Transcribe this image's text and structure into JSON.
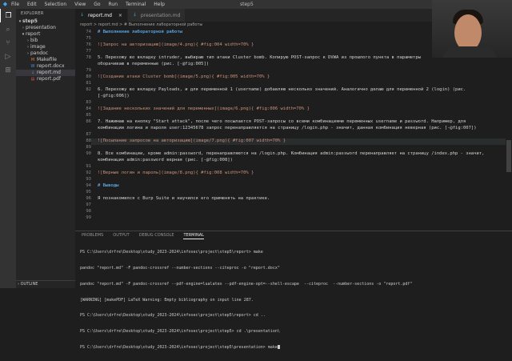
{
  "window": {
    "title": "step5",
    "menu": [
      "File",
      "Edit",
      "Selection",
      "View",
      "Go",
      "Run",
      "Terminal",
      "Help"
    ]
  },
  "sidebar": {
    "header": "EXPLORER",
    "root": "step5",
    "items": [
      {
        "label": "presentation",
        "kind": "folder",
        "collapsed": true
      },
      {
        "label": "report",
        "kind": "folder",
        "collapsed": false
      },
      {
        "label": "bib",
        "kind": "folder",
        "collapsed": true
      },
      {
        "label": "image",
        "kind": "folder",
        "collapsed": true
      },
      {
        "label": "pandoc",
        "kind": "folder",
        "collapsed": true
      },
      {
        "label": "Makefile",
        "kind": "file"
      },
      {
        "label": "report.docx",
        "kind": "file"
      },
      {
        "label": "report.md",
        "kind": "file",
        "selected": true
      },
      {
        "label": "report.pdf",
        "kind": "file"
      }
    ],
    "outline": "OUTLINE"
  },
  "tabs": [
    {
      "label": "report.md",
      "active": true
    },
    {
      "label": "presentation.md",
      "active": false
    }
  ],
  "breadcrumb": "report > report.md > # Выполнение лабораторной работы",
  "editor": {
    "lines": [
      {
        "n": "74",
        "text": "# Выполнение лабораторной работы",
        "type": "heading"
      },
      {
        "n": "75",
        "text": ""
      },
      {
        "n": "76",
        "text": "![Запрос на авторизацию](image/4.png){ #fig:004 width=70% }",
        "type": "img"
      },
      {
        "n": "77",
        "text": ""
      },
      {
        "n": "78",
        "text": "5. Перехожу во вкладку intruder, выбираю тип атаки Cluster bomb. Копирую POST-запрос к DVWA из прошлого пункта в параметры"
      },
      {
        "n": "",
        "text": "оборачиваю в переменные (рис. [-@fig:005])"
      },
      {
        "n": "79",
        "text": ""
      },
      {
        "n": "80",
        "text": "![Создание атаки Cluster bomb](image/5.png){ #fig:005 width=70% }",
        "type": "img"
      },
      {
        "n": "81",
        "text": ""
      },
      {
        "n": "82",
        "text": "6. Перехожу во вкладку Payloads, и для переменной 1 (username) добавляю несколько значений. Аналогично делаю для переменной 2 (login) (рис."
      },
      {
        "n": "",
        "text": "[-@fig:006])"
      },
      {
        "n": "83",
        "text": ""
      },
      {
        "n": "84",
        "text": "![Задание нескольких значений для переменных](image/6.png){ #fig:006 width=70% }",
        "type": "img"
      },
      {
        "n": "85",
        "text": ""
      },
      {
        "n": "86",
        "text": "7. Нажимаю на кнопку \"Start attack\", после чего посылается POST-запросы со всеми комбинациями переменных username и password. Например, для"
      },
      {
        "n": "",
        "text": "комбинации логина и пароля user:12345678 запрос перенаправляется на страницу /login.php - значит, данная комбинация неверная (рис. [-@fig:007])"
      },
      {
        "n": "87",
        "text": ""
      },
      {
        "n": "88",
        "text": "![Посылание запросов на авторизацию](image/7.png){ #fig:007 width=70% }",
        "type": "img",
        "current": true
      },
      {
        "n": "89",
        "text": ""
      },
      {
        "n": "90",
        "text": "8. Все комбинации, кроме admin:password, перенаправляются на /login.php. Комбинация admin:password перенаправляет на страницу /index.php - значит,"
      },
      {
        "n": "",
        "text": "комбинация admin:password верная (рис. [-@fig:008])"
      },
      {
        "n": "91",
        "text": ""
      },
      {
        "n": "92",
        "text": "![Верные логин и пароль](image/8.png){ #fig:008 width=70% }",
        "type": "img"
      },
      {
        "n": "93",
        "text": ""
      },
      {
        "n": "94",
        "text": "# Выводы",
        "type": "heading"
      },
      {
        "n": "95",
        "text": ""
      },
      {
        "n": "96",
        "text": "Я познакомился с Burp Suite и научился его применять на практике."
      },
      {
        "n": "97",
        "text": ""
      },
      {
        "n": "98",
        "text": ""
      },
      {
        "n": "99",
        "text": ""
      }
    ]
  },
  "panel": {
    "tabs": [
      "PROBLEMS",
      "OUTPUT",
      "DEBUG CONSOLE",
      "TERMINAL"
    ],
    "active_tab": "TERMINAL",
    "terminal": [
      "PS C:\\Users\\drfre\\Desktop\\study_2023-2024\\infosec\\project\\step5\\report> make",
      "pandoc \"report.md\" -F pandoc-crossref --number-sections --citeproc -o \"report.docx\"",
      "pandoc \"report.md\" -F pandoc-crossref --pdf-engine=lualatex --pdf-engine-opt=--shell-escape  --citeproc  --number-sections -o \"report.pdf\"",
      "[WARNING] [makePDF] LaTeX Warning: Empty bibliography on input line 287.",
      "PS C:\\Users\\drfre\\Desktop\\study_2023-2024\\infosec\\project\\step5\\report> cd ..",
      "PS C:\\Users\\drfre\\Desktop\\study_2023-2024\\infosec\\project\\step5> cd .\\presentation\\",
      "PS C:\\Users\\drfre\\Desktop\\study_2023-2024\\infosec\\project\\step5\\presentation> make"
    ]
  }
}
